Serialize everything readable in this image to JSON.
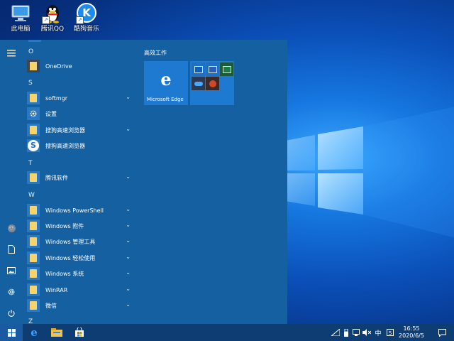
{
  "desktop": {
    "icons": [
      {
        "label": "此电脑",
        "icon": "computer-icon"
      },
      {
        "label": "腾讯QQ",
        "icon": "qq-penguin-icon"
      },
      {
        "label": "酷狗音乐",
        "icon": "kugou-music-icon",
        "glyph": "K"
      }
    ]
  },
  "start_menu": {
    "rail": {
      "items": [
        "hamburger-menu-icon",
        "user-account-icon",
        "documents-icon",
        "pictures-icon",
        "settings-gear-icon",
        "power-icon"
      ]
    },
    "app_list": {
      "letters": {
        "o": "O",
        "s": "S",
        "t": "T",
        "w": "W",
        "z": "Z"
      },
      "items": [
        {
          "label": "OneDrive",
          "icon": "onedrive-icon"
        },
        {
          "label": "softmgr",
          "icon": "folder-icon",
          "expandable": true
        },
        {
          "label": "设置",
          "icon": "settings-icon"
        },
        {
          "label": "搜狗高速浏览器",
          "icon": "folder-icon",
          "expandable": true
        },
        {
          "label": "搜狗高速浏览器",
          "icon": "sogou-browser-icon"
        },
        {
          "label": "腾讯软件",
          "icon": "folder-icon",
          "expandable": true
        },
        {
          "label": "Windows PowerShell",
          "icon": "folder-icon",
          "expandable": true
        },
        {
          "label": "Windows 附件",
          "icon": "folder-icon",
          "expandable": true
        },
        {
          "label": "Windows 管理工具",
          "icon": "folder-icon",
          "expandable": true
        },
        {
          "label": "Windows 轻松使用",
          "icon": "folder-icon",
          "expandable": true
        },
        {
          "label": "Windows 系统",
          "icon": "folder-icon",
          "expandable": true
        },
        {
          "label": "WinRAR",
          "icon": "folder-icon",
          "expandable": true
        },
        {
          "label": "微信",
          "icon": "folder-icon",
          "expandable": true
        }
      ]
    },
    "tiles": {
      "group_title": "高效工作",
      "edge": {
        "label": "Microsoft Edge",
        "glyph": "e"
      },
      "office_minis": [
        "outlook-icon",
        "word-icon",
        "excel-icon",
        "onedrive-icon",
        "powerpoint-icon"
      ]
    }
  },
  "taskbar": {
    "pinned": [
      "windows-start-icon",
      "edge-icon",
      "file-explorer-icon",
      "store-icon"
    ],
    "tray": {
      "ime": "中",
      "time": "16:55",
      "date": "2020/6/5"
    },
    "colors": {
      "taskbar": "#0e3d74",
      "start_menu": "#1560a0",
      "tile": "#1e7ad0"
    }
  }
}
